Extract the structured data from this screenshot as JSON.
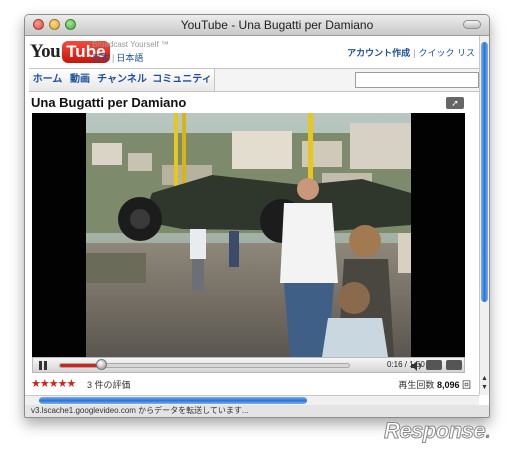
{
  "window": {
    "title": "YouTube - Una Bugatti per Damiano"
  },
  "header": {
    "logo_you": "You",
    "logo_tube": "Tube",
    "tagline": "Broadcast Yourself ™",
    "lang_japan": "日本",
    "lang_japanese": "日本語",
    "create_account": "アカウント作成",
    "quick_list": "クイック リス"
  },
  "nav": {
    "tabs": [
      "ホーム",
      "動画",
      "チャンネル",
      "コミュニティ"
    ]
  },
  "search": {
    "value": ""
  },
  "video": {
    "title": "Una Bugatti per Damiano",
    "time_current": "0:16",
    "time_total": "1:50",
    "time_display": "0:16 / 1:50",
    "progress_fraction": 0.145
  },
  "stats": {
    "stars": "★★★★★",
    "rating_count": "3 件の評価",
    "views_label": "再生回数",
    "views_count": "8,096",
    "views_unit": "回"
  },
  "status_bar": {
    "text": "v3.lscache1.googlevideo.com からデータを転送しています..."
  },
  "watermark": {
    "text": "Response",
    "dot": "."
  },
  "colors": {
    "accent": "#d0241b",
    "link": "#1e4f9a",
    "scroll": "#2a72d8"
  }
}
